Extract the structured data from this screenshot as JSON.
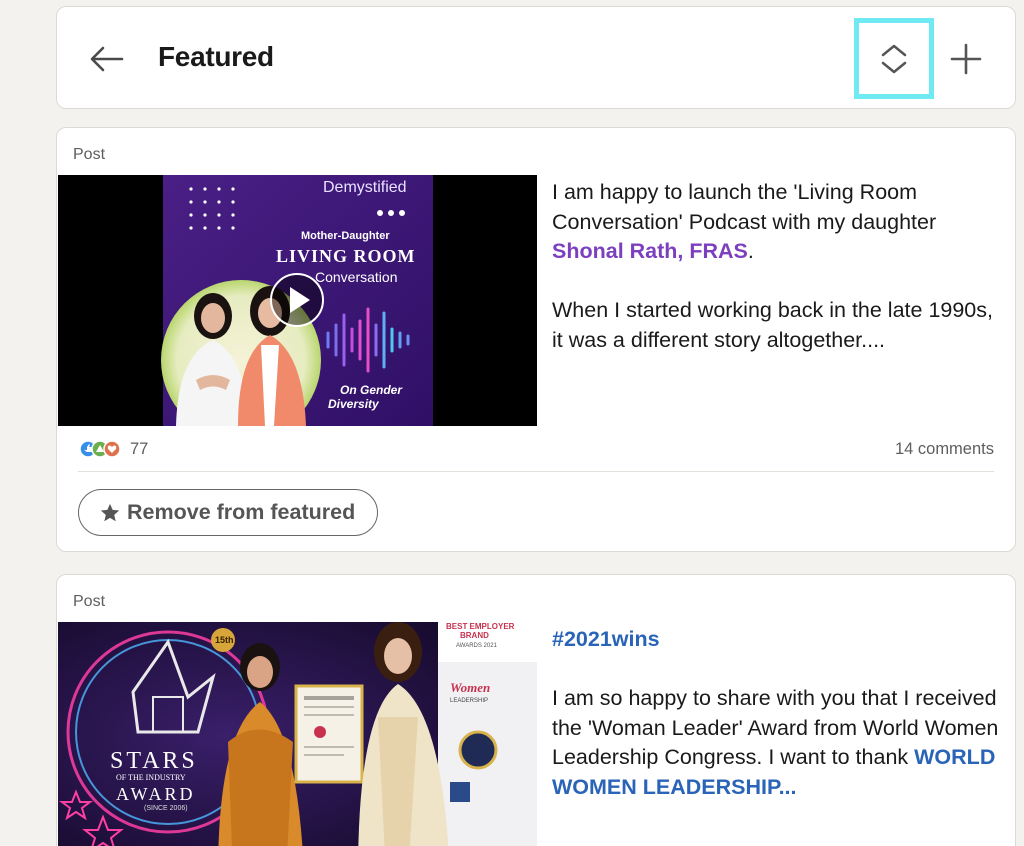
{
  "header": {
    "title": "Featured",
    "back_icon": "arrow-left-icon",
    "reorder_icon": "chevron-up-down-icon",
    "add_icon": "plus-icon",
    "highlight_color": "#6fe9f2"
  },
  "posts": [
    {
      "label": "Post",
      "media": {
        "title_top": "Demystified",
        "subtitle": "Mother-Daughter",
        "title_main": "LIVING ROOM",
        "title_sub": "Conversation",
        "tag_line1": "On Gender",
        "tag_line2": "Diversity"
      },
      "text_p1_before": "I am happy to launch the 'Living Room Conversation' Podcast with my daughter ",
      "mention": "Shonal Rath, FRAS",
      "text_p1_after": ".",
      "text_p2": "When I started working back in the late 1990s, it was a different story altogether....",
      "reaction_count": "77",
      "comments": "14 comments",
      "remove_label": "Remove from featured"
    },
    {
      "label": "Post",
      "media": {
        "award_big": "STARS",
        "award_small": "OF THE INDUSTRY",
        "award_line": "AWARD",
        "award_since": "(SINCE 2006)",
        "edition": "15th",
        "banner1": "BEST EMPLOYER",
        "banner2": "BRAND",
        "banner3": "AWARDS 2021",
        "banner_women": "Women",
        "banner_leadership": "LEADERSHIP"
      },
      "hashtag": "#2021wins",
      "text_p2_before": "I am so happy to share with you that I received the 'Woman Leader' Award from World Women Leadership Congress. I want to thank ",
      "mention": "WORLD WOMEN LEADERSHIP..."
    }
  ]
}
